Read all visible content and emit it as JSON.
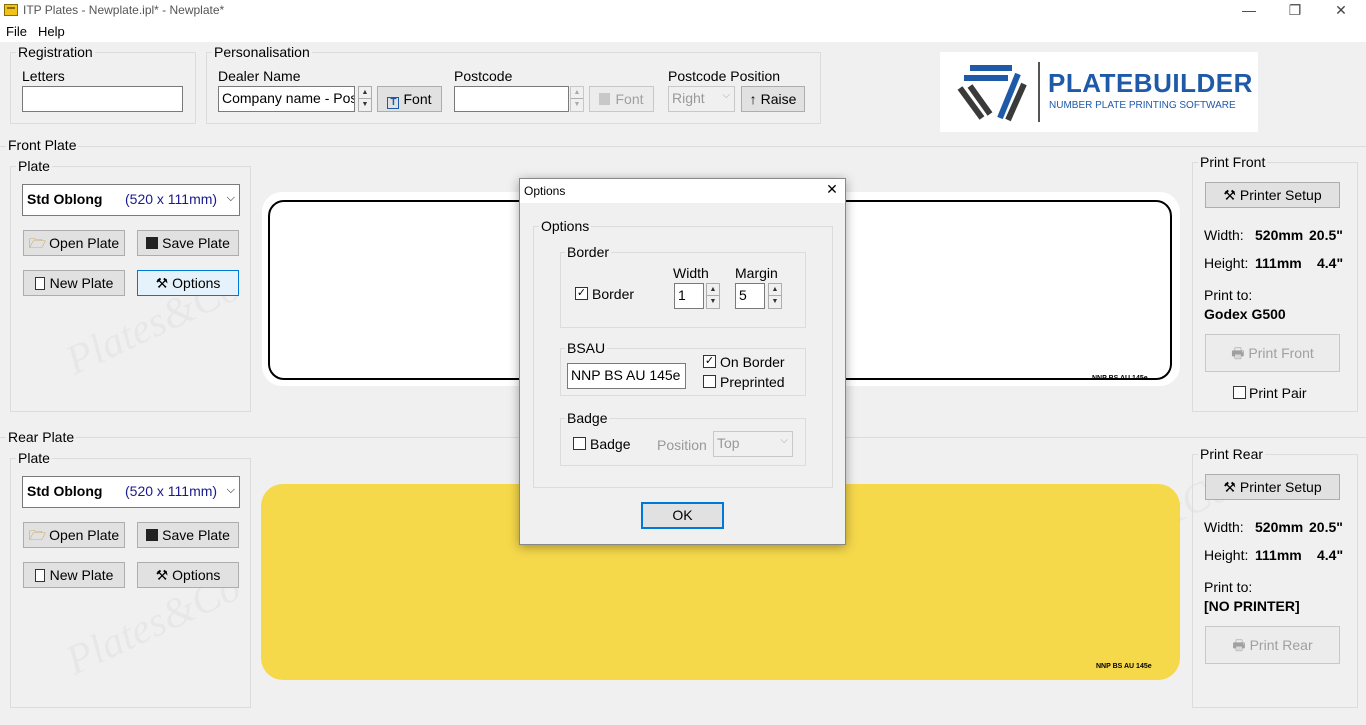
{
  "window": {
    "title": "ITP Plates - Newplate.ipl* - Newplate*",
    "minimize": "—",
    "restore": "❐",
    "close": "✕"
  },
  "menu": {
    "file": "File",
    "help": "Help"
  },
  "registration": {
    "group": "Registration",
    "letters_label": "Letters",
    "letters_value": ""
  },
  "personalisation": {
    "group": "Personalisation",
    "dealer_label": "Dealer Name",
    "dealer_value": "Company name - Pos",
    "font_btn": "Font",
    "postcode_label": "Postcode",
    "postcode_value": "",
    "postcode_font_btn": "Font",
    "pos_label": "Postcode Position",
    "pos_value": "Right",
    "raise_btn": "Raise"
  },
  "logo": {
    "title": "PLATEBUILDER",
    "subtitle": "NUMBER PLATE PRINTING SOFTWARE"
  },
  "front": {
    "group": "Front Plate",
    "plate_group": "Plate",
    "plate_name": "Std Oblong",
    "plate_size": "(520 x 111mm)",
    "open": "Open Plate",
    "save": "Save Plate",
    "new": "New Plate",
    "options": "Options",
    "bsau": "NNP BS AU 145e"
  },
  "rear": {
    "group": "Rear Plate",
    "plate_group": "Plate",
    "plate_name": "Std Oblong",
    "plate_size": "(520 x 111mm)",
    "open": "Open Plate",
    "save": "Save Plate",
    "new": "New Plate",
    "options": "Options",
    "bsau": "NNP BS AU 145e"
  },
  "print_front": {
    "group": "Print Front",
    "setup": "Printer Setup",
    "width_label": "Width:",
    "width_mm": "520mm",
    "width_in": "20.5\"",
    "height_label": "Height:",
    "height_mm": "111mm",
    "height_in": "4.4\"",
    "print_to_label": "Print to:",
    "printer": "Godex G500",
    "print_btn": "Print Front",
    "pair": "Print Pair"
  },
  "print_rear": {
    "group": "Print Rear",
    "setup": "Printer Setup",
    "width_label": "Width:",
    "width_mm": "520mm",
    "width_in": "20.5\"",
    "height_label": "Height:",
    "height_mm": "111mm",
    "height_in": "4.4\"",
    "print_to_label": "Print to:",
    "printer": "[NO PRINTER]",
    "print_btn": "Print Rear"
  },
  "dialog": {
    "title": "Options",
    "close": "✕",
    "options_group": "Options",
    "border_group": "Border",
    "border_check": "Border",
    "width_label": "Width",
    "width_value": "1",
    "margin_label": "Margin",
    "margin_value": "5",
    "bsau_group": "BSAU",
    "bsau_value": "NNP BS AU 145e",
    "on_border": "On Border",
    "preprinted": "Preprinted",
    "badge_group": "Badge",
    "badge_check": "Badge",
    "position_label": "Position",
    "position_value": "Top",
    "ok": "OK"
  },
  "watermark": "Plates&Co",
  "colors": {
    "rear_plate": "#f6d84b",
    "front_plate": "#ffffff",
    "focus": "#0078d7"
  }
}
